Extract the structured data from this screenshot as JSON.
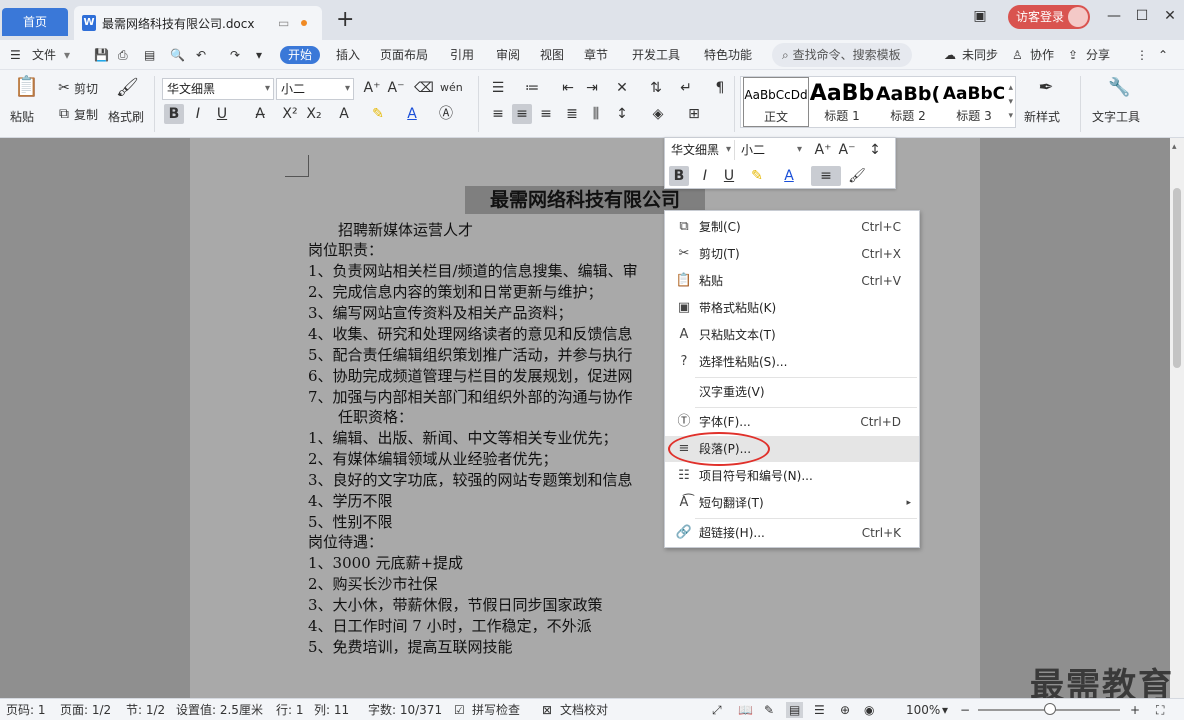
{
  "titlebar": {
    "home_tab": "首页",
    "doc_icon": "W",
    "doc_tab": "最需网络科技有限公司.docx",
    "login": "访客登录"
  },
  "menu": {
    "file": "文件",
    "tabs": [
      "开始",
      "插入",
      "页面布局",
      "引用",
      "审阅",
      "视图",
      "章节",
      "开发工具",
      "特色功能"
    ],
    "search": "查找命令、搜索模板",
    "unsync": "未同步",
    "collab": "协作",
    "share": "分享"
  },
  "ribbon": {
    "paste": "粘贴",
    "cut": "剪切",
    "copy": "复制",
    "format_painter": "格式刷",
    "font_name": "华文细黑",
    "font_size": "小二",
    "styles": [
      {
        "sample": "AaBbCcDd",
        "label": "正文"
      },
      {
        "sample": "AaBb",
        "label": "标题 1"
      },
      {
        "sample": "AaBb(",
        "label": "标题 2"
      },
      {
        "sample": "AaBbC",
        "label": "标题 3"
      }
    ],
    "new_style": "新样式",
    "text_tools": "文字工具"
  },
  "document": {
    "title": "最需网络科技有限公司",
    "lines": [
      "　　招聘新媒体运营人才",
      "岗位职责：",
      "1、负责网站相关栏目/频道的信息搜集、编辑、审",
      "2、完成信息内容的策划和日常更新与维护；",
      "3、编写网站宣传资料及相关产品资料；",
      "4、收集、研究和处理网络读者的意见和反馈信息",
      "5、配合责任编辑组织策划推广活动，并参与执行",
      "6、协助完成频道管理与栏目的发展规划，促进网",
      "7、加强与内部相关部门和组织外部的沟通与协作",
      "　　任职资格：",
      "1、编辑、出版、新闻、中文等相关专业优先；",
      "2、有媒体编辑领域从业经验者优先；",
      "3、良好的文字功底，较强的网站专题策划和信息",
      "4、学历不限",
      "5、性别不限",
      "岗位待遇：",
      "1、3000 元底薪+提成",
      "2、购买长沙市社保",
      "3、大小休，带薪休假，节假日同步国家政策",
      "4、日工作时间 7 小时，工作稳定，不外派",
      "5、免费培训，提高互联网技能"
    ]
  },
  "mini_toolbar": {
    "font_name": "华文细黑",
    "font_size": "小二"
  },
  "context_menu": [
    {
      "label": "复制(C)",
      "shortcut": "Ctrl+C",
      "icon": "copy-icon"
    },
    {
      "label": "剪切(T)",
      "shortcut": "Ctrl+X",
      "icon": "scissors-icon"
    },
    {
      "label": "粘贴",
      "shortcut": "Ctrl+V",
      "icon": "paste-icon"
    },
    {
      "label": "带格式粘贴(K)",
      "shortcut": "",
      "icon": "paste-format-icon"
    },
    {
      "label": "只粘贴文本(T)",
      "shortcut": "",
      "icon": "paste-text-icon"
    },
    {
      "label": "选择性粘贴(S)...",
      "shortcut": "",
      "icon": "paste-special-icon"
    },
    {
      "label": "汉字重选(V)",
      "shortcut": "",
      "icon": ""
    },
    {
      "label": "字体(F)...",
      "shortcut": "Ctrl+D",
      "icon": "font-icon"
    },
    {
      "label": "段落(P)...",
      "shortcut": "",
      "icon": "paragraph-icon"
    },
    {
      "label": "项目符号和编号(N)...",
      "shortcut": "",
      "icon": "list-icon"
    },
    {
      "label": "短句翻译(T)",
      "shortcut": "",
      "icon": "translate-icon"
    },
    {
      "label": "超链接(H)...",
      "shortcut": "Ctrl+K",
      "icon": "link-icon"
    }
  ],
  "statusbar": {
    "page_num": "页码: 1",
    "page": "页面: 1/2",
    "section": "节: 1/2",
    "setting": "设置值: 2.5厘米",
    "row": "行: 1",
    "col": "列: 11",
    "words": "字数: 10/371",
    "spell": "拼写检查",
    "proof": "文档校对",
    "zoom": "100%"
  },
  "watermark": "最需教育",
  "colors": {
    "accent": "#3a78d8",
    "highlight_ring": "#e0312b",
    "login_btn": "#d9534f"
  }
}
